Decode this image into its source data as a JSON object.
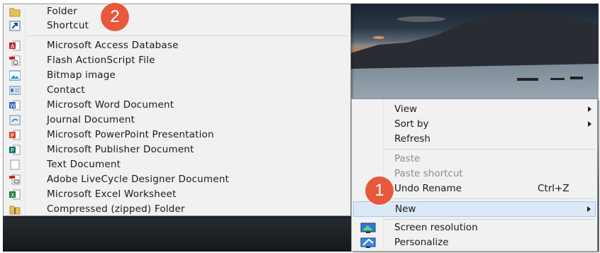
{
  "new_submenu": {
    "items": [
      {
        "label": "Folder",
        "icon": "folder-icon"
      },
      {
        "label": "Shortcut",
        "icon": "shortcut-icon"
      },
      {
        "label": "Microsoft Access Database",
        "icon": "access-icon"
      },
      {
        "label": "Flash ActionScript File",
        "icon": "actionscript-icon"
      },
      {
        "label": "Bitmap image",
        "icon": "bitmap-icon"
      },
      {
        "label": "Contact",
        "icon": "contact-icon"
      },
      {
        "label": "Microsoft Word Document",
        "icon": "word-icon"
      },
      {
        "label": "Journal Document",
        "icon": "journal-icon"
      },
      {
        "label": "Microsoft PowerPoint Presentation",
        "icon": "powerpoint-icon"
      },
      {
        "label": "Microsoft Publisher Document",
        "icon": "publisher-icon"
      },
      {
        "label": "Text Document",
        "icon": "text-document-icon"
      },
      {
        "label": "Adobe LiveCycle Designer Document",
        "icon": "livecycle-icon"
      },
      {
        "label": "Microsoft Excel Worksheet",
        "icon": "excel-icon"
      },
      {
        "label": "Compressed (zipped) Folder",
        "icon": "zip-folder-icon"
      }
    ]
  },
  "context_menu": {
    "view": {
      "label": "View"
    },
    "sort_by": {
      "label": "Sort by"
    },
    "refresh": {
      "label": "Refresh"
    },
    "paste": {
      "label": "Paste",
      "disabled": true
    },
    "paste_shortcut": {
      "label": "Paste shortcut",
      "disabled": true
    },
    "undo_rename": {
      "label": "Undo Rename",
      "shortcut": "Ctrl+Z"
    },
    "new": {
      "label": "New",
      "highlighted": true
    },
    "screen_resolution": {
      "label": "Screen resolution",
      "icon": "monitor-icon"
    },
    "personalize": {
      "label": "Personalize",
      "icon": "personalize-icon"
    }
  },
  "callouts": {
    "one": "1",
    "two": "2"
  },
  "colors": {
    "badge": "#e8583d",
    "menu_bg": "#f1f1f1",
    "highlight": "#dbe8f6"
  }
}
